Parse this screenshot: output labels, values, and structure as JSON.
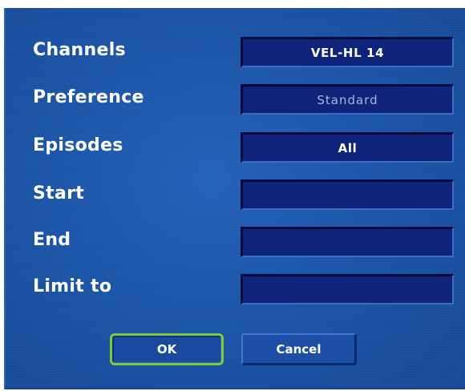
{
  "form": {
    "rows": [
      {
        "label": "Channels",
        "value": "VEL-HL 14"
      },
      {
        "label": "Preference",
        "value": "Standard"
      },
      {
        "label": "Episodes",
        "value": "All"
      },
      {
        "label": "Start",
        "value": ""
      },
      {
        "label": "End",
        "value": ""
      },
      {
        "label": "Limit to",
        "value": ""
      }
    ]
  },
  "buttons": {
    "ok_label": "OK",
    "cancel_label": "Cancel"
  },
  "colors": {
    "background": "#1d55a8",
    "field_background": "#10237a",
    "focus_highlight": "#7fc93a",
    "text": "#ffffff",
    "dim_text": "#a9b6d6"
  }
}
